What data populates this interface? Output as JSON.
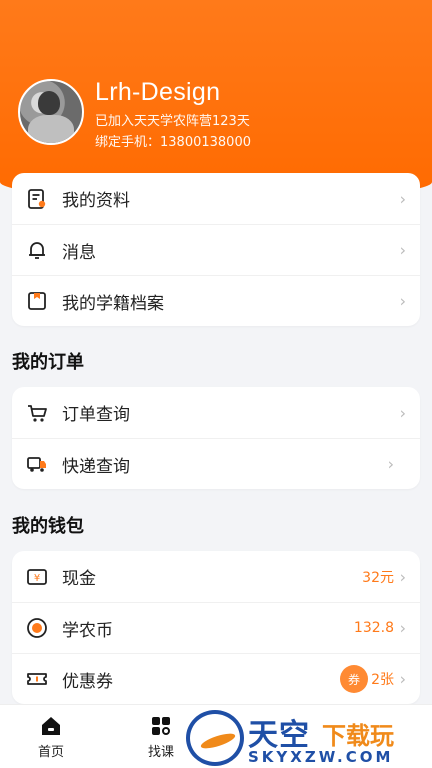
{
  "profile": {
    "name": "Lrh-Design",
    "joined": "已加入天天学农阵营123天",
    "phone": "绑定手机：13800138000"
  },
  "account_menu": [
    {
      "label": "我的资料",
      "icon": "profile-doc-icon"
    },
    {
      "label": "消息",
      "icon": "bell-icon"
    },
    {
      "label": "我的学籍档案",
      "icon": "archive-icon"
    }
  ],
  "orders": {
    "title": "我的订单",
    "items": [
      {
        "label": "订单查询",
        "icon": "cart-icon"
      },
      {
        "label": "快递查询",
        "icon": "truck-icon"
      }
    ]
  },
  "wallet": {
    "title": "我的钱包",
    "items": [
      {
        "label": "现金",
        "icon": "cash-icon",
        "value": "32元"
      },
      {
        "label": "学农币",
        "icon": "coin-icon",
        "value": "132.8"
      },
      {
        "label": "优惠券",
        "icon": "coupon-icon",
        "value": "2张",
        "badge": "券"
      }
    ]
  },
  "tabbar": [
    {
      "label": "首页",
      "icon": "home-icon"
    },
    {
      "label": "找课",
      "icon": "find-course-icon"
    }
  ],
  "watermark": {
    "title": "天空",
    "subtitle": "下载玩",
    "domain": "SKYXZW.COM"
  },
  "colors": {
    "accent": "#ff6a00",
    "value": "#ff7a1a"
  }
}
